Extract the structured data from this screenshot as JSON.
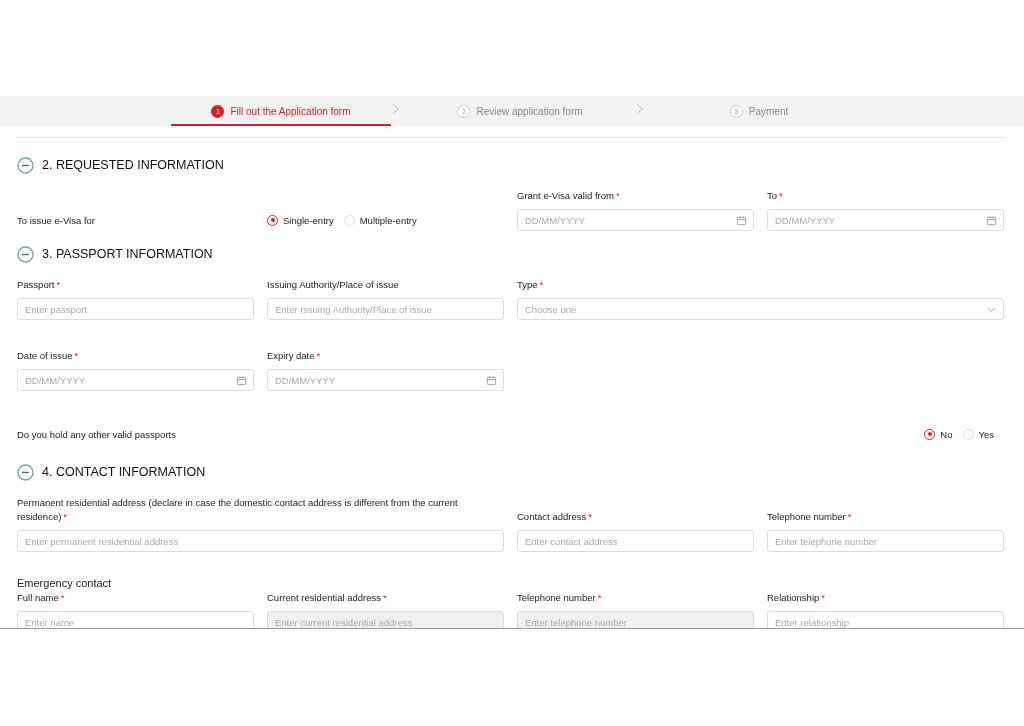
{
  "steps": [
    {
      "number": "1",
      "label": "Fill out the Application form",
      "selected": true
    },
    {
      "number": "2",
      "label": "Review application form",
      "selected": false
    },
    {
      "number": "3",
      "label": "Payment",
      "selected": false
    }
  ],
  "sections": [
    {
      "title": "2. REQUESTED INFORMATION",
      "expanded": true,
      "rows": [
        {
          "kind": "fields",
          "items": [
            {
              "kind": "label",
              "text": "To issue e-Visa for"
            },
            {
              "kind": "radio",
              "options": [
                {
                  "label": "Single-entry",
                  "selected": true
                },
                {
                  "label": "Multiple-entry",
                  "selected": false
                }
              ]
            },
            {
              "kind": "date",
              "label": "Grant e-Visa valid from",
              "required_mark": "*",
              "placeholder": "DD/MM/YYYY",
              "disabled": false
            },
            {
              "kind": "date",
              "label": "To",
              "required_mark": "*",
              "placeholder": "DD/MM/YYYY",
              "disabled": false
            }
          ]
        }
      ]
    },
    {
      "title": "3. PASSPORT INFORMATION",
      "expanded": true,
      "rows": [
        {
          "kind": "fields",
          "items": [
            {
              "kind": "text",
              "label": "Passport",
              "required_mark": "*",
              "placeholder": "Enter passport",
              "disabled": false
            },
            {
              "kind": "text",
              "label": "Issuing Authority/Place of issue",
              "placeholder": "Enter Issuing Authority/Place of issue",
              "disabled": false
            },
            {
              "kind": "wide_select",
              "label": "Type",
              "required_mark": "*",
              "placeholder": "Choose one",
              "disabled": false
            }
          ]
        },
        {
          "kind": "fields",
          "items": [
            {
              "kind": "date",
              "label": "Date of issue",
              "required_mark": "*",
              "placeholder": "DD/MM/YYYY",
              "disabled": false
            },
            {
              "kind": "date",
              "label": "Expiry date",
              "required_mark": "*",
              "placeholder": "DD/MM/YYYY",
              "disabled": false
            }
          ]
        },
        {
          "kind": "fields",
          "items": [
            {
              "kind": "question",
              "text": "Do you hold any other valid passports"
            },
            {
              "kind": "radio_end",
              "options": [
                {
                  "label": "No",
                  "selected": true
                },
                {
                  "label": "Yes",
                  "selected": false
                }
              ]
            }
          ]
        }
      ]
    },
    {
      "title": "4. CONTACT INFORMATION",
      "expanded": true,
      "rows": [
        {
          "kind": "fields",
          "items": [
            {
              "kind": "wide_text",
              "label": "Permanent residential address (declare in case the domestic contact address is different from the current residence)",
              "required_mark": "*",
              "placeholder": "Enter permanent residential address",
              "disabled": false
            },
            {
              "kind": "text",
              "label": "Contact address",
              "required_mark": "*",
              "placeholder": "Enter contact address",
              "disabled": false
            },
            {
              "kind": "text",
              "label": "Telephone number",
              "required_mark": "*",
              "placeholder": "Enter telephone number",
              "disabled": false
            }
          ]
        },
        {
          "kind": "subheading",
          "text": "Emergency contact"
        },
        {
          "kind": "fields",
          "items": [
            {
              "kind": "text",
              "label": "Full name",
              "required_mark": "*",
              "placeholder": "Enter name",
              "disabled": false
            },
            {
              "kind": "text",
              "label": "Current residential address",
              "required_mark": "*",
              "placeholder": "Enter current residential address",
              "disabled": true
            },
            {
              "kind": "text",
              "label": "Telephone number",
              "required_mark": "*",
              "placeholder": "Enter telephone number",
              "disabled": true
            },
            {
              "kind": "text",
              "label": "Relationship",
              "required_mark": "*",
              "placeholder": "Enter relationship",
              "disabled": false
            }
          ]
        }
      ]
    }
  ]
}
